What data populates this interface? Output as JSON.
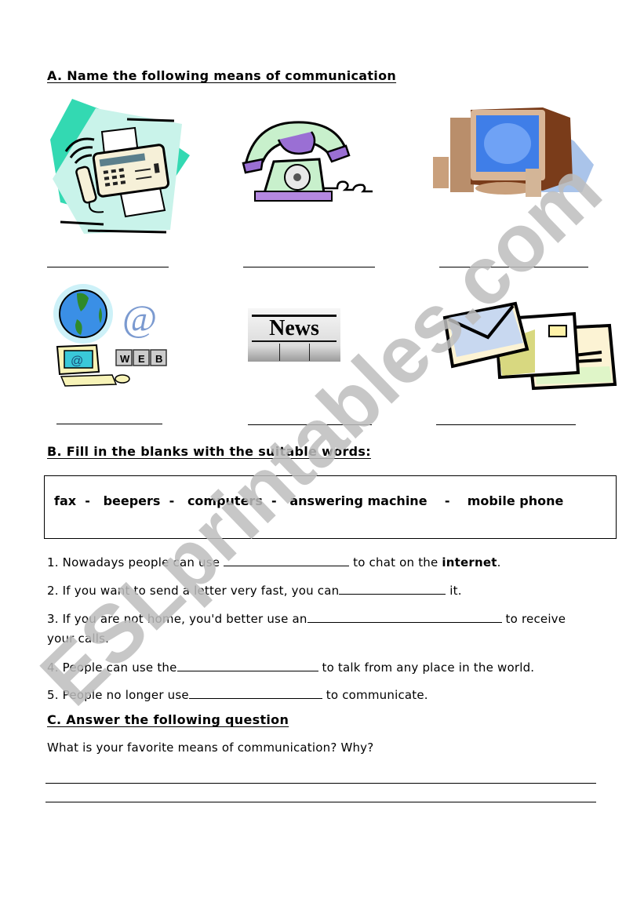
{
  "section_a": {
    "heading": "A. Name the following means of communication",
    "pictures": [
      {
        "icon": "fax-machine-icon",
        "alt": "fax machine"
      },
      {
        "icon": "rotary-telephone-icon",
        "alt": "telephone"
      },
      {
        "icon": "desktop-computer-icon",
        "alt": "computer"
      },
      {
        "icon": "internet-email-icon",
        "alt": "internet / e-mail",
        "key_labels": [
          "W",
          "E",
          "B"
        ],
        "at_symbol": "@"
      },
      {
        "icon": "newspaper-icon",
        "alt": "newspaper",
        "masthead": "News"
      },
      {
        "icon": "letters-envelopes-icon",
        "alt": "letters"
      }
    ]
  },
  "section_b": {
    "heading": "B. Fill in the blanks with the suitable words:",
    "word_bank": "fax  -   beepers  -   computers  -   answering machine    -    mobile phone",
    "sentences": [
      {
        "before": "1. Nowadays people can use ",
        "after": " to chat on the ",
        "bold": "internet",
        "end": "."
      },
      {
        "before": "2. If you want to send a letter very fast, you can",
        "after": " it."
      },
      {
        "before": "3. If you are not home, you'd better use an",
        "after": " to receive",
        "continuation": "your calls."
      },
      {
        "before": "4. People can use the",
        "after": " to talk from any place in the world."
      },
      {
        "before": "5. People no longer use",
        "after": " to communicate."
      }
    ]
  },
  "section_c": {
    "heading": "C. Answer the following question",
    "question": "What is your favorite means of communication? Why?"
  },
  "watermark": {
    "text": "ESLprintables.com",
    "color": "#bdbdbd"
  }
}
